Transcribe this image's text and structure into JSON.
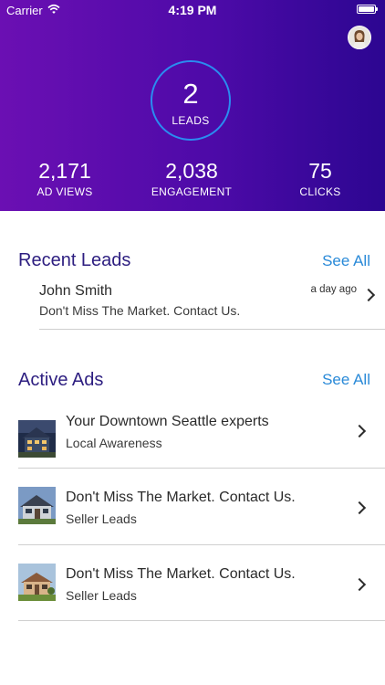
{
  "status_bar": {
    "carrier": "Carrier",
    "time": "4:19 PM"
  },
  "stats": {
    "leads": {
      "value": "2",
      "label": "LEADS"
    },
    "ad_views": {
      "value": "2,171",
      "label": "AD VIEWS"
    },
    "engagement": {
      "value": "2,038",
      "label": "ENGAGEMENT"
    },
    "clicks": {
      "value": "75",
      "label": "CLICKS"
    }
  },
  "recent_leads": {
    "title": "Recent Leads",
    "see_all": "See All",
    "items": [
      {
        "name": "John Smith",
        "message": "Don't Miss The Market. Contact Us.",
        "time": "a day ago"
      }
    ]
  },
  "active_ads": {
    "title": "Active Ads",
    "see_all": "See All",
    "items": [
      {
        "title": "Your Downtown Seattle experts",
        "subtitle": "Local Awareness"
      },
      {
        "title": "Don't Miss The Market. Contact Us.",
        "subtitle": "Seller Leads"
      },
      {
        "title": "Don't Miss The Market. Contact Us.",
        "subtitle": "Seller Leads"
      }
    ]
  },
  "colors": {
    "header_start": "#6b0fb3",
    "header_end": "#2c0691",
    "accent": "#2a8ad8",
    "section_title": "#2d1e80",
    "ring": "#2a8cf0"
  },
  "icons": {
    "wifi": "wifi-icon",
    "battery": "battery-icon",
    "chevron": "chevron-right-icon",
    "avatar": "user-avatar"
  }
}
